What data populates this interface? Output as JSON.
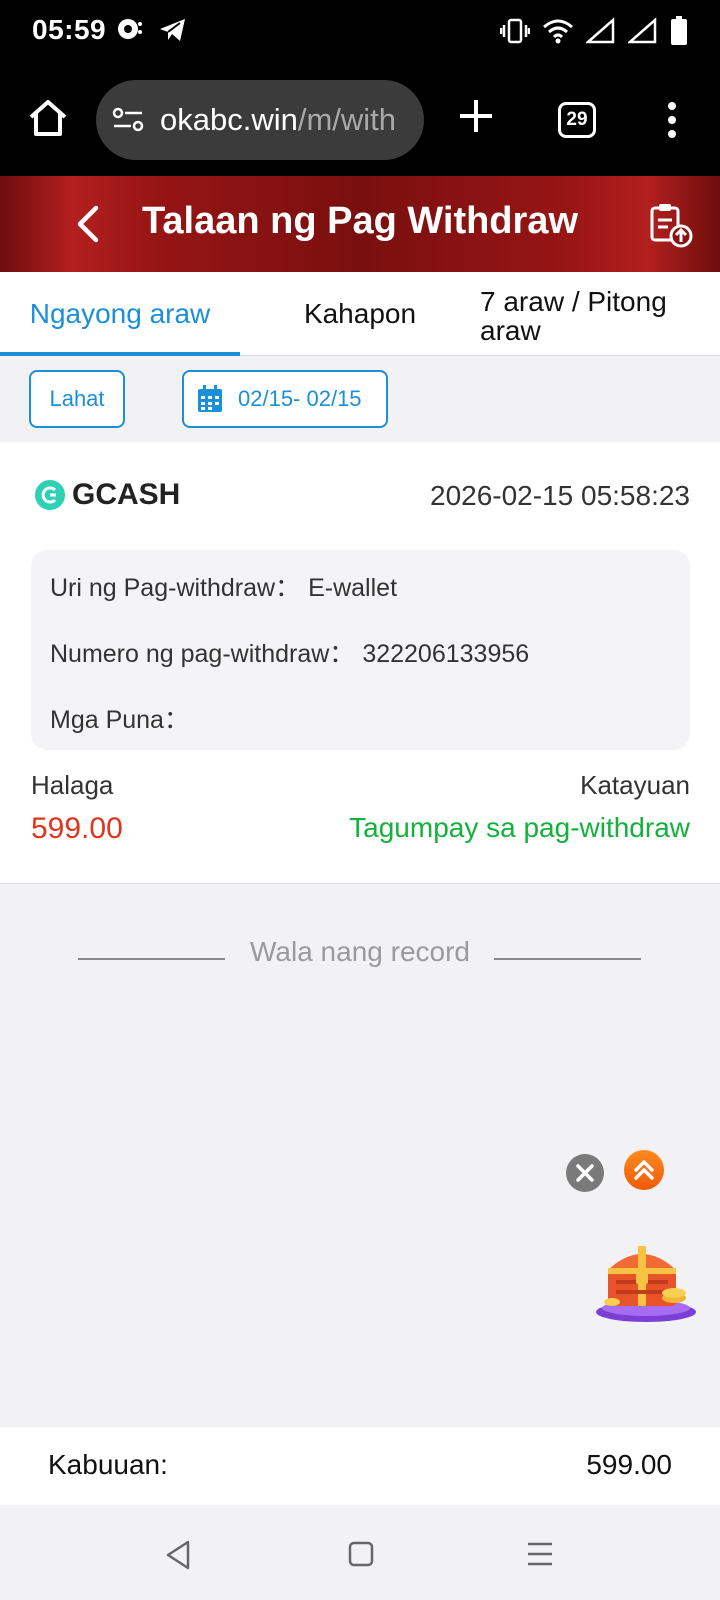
{
  "status_bar": {
    "time": "05:59",
    "left_icons": [
      "chat-bubble-icon",
      "telegram-icon"
    ],
    "right_icons": [
      "vibrate-icon",
      "wifi-icon",
      "signal-icon",
      "signal-icon",
      "battery-icon"
    ]
  },
  "browser": {
    "url_domain": "okabc.win",
    "url_path": "/m/with",
    "tab_count": "29"
  },
  "header": {
    "title": "Talaan ng Pag Withdraw"
  },
  "tabs": [
    {
      "label": "Ngayong araw",
      "active": true
    },
    {
      "label": "Kahapon",
      "active": false
    },
    {
      "label": "7 araw / Pitong araw",
      "active": false
    }
  ],
  "filters": {
    "all_label": "Lahat",
    "date_range": "02/15- 02/15"
  },
  "record": {
    "provider": "GCASH",
    "datetime": "2026-02-15 05:58:23",
    "type_label": "Uri ng Pag-withdraw：",
    "type_value": "E-wallet",
    "number_label": "Numero ng pag-withdraw：",
    "number_value": "322206133956",
    "remarks_label": "Mga Puna：",
    "remarks_value": "",
    "amount_label": "Halaga",
    "amount_value": "599.00",
    "status_label": "Katayuan",
    "status_value": "Tagumpay sa pag-withdraw"
  },
  "list_end": {
    "text": "Wala nang record"
  },
  "total": {
    "label": "Kabuuan:",
    "value": "599.00"
  },
  "colors": {
    "accent_blue": "#1b8fd8",
    "header_red": "#961515",
    "amount_red": "#e0341f",
    "success_green": "#12b23c"
  }
}
